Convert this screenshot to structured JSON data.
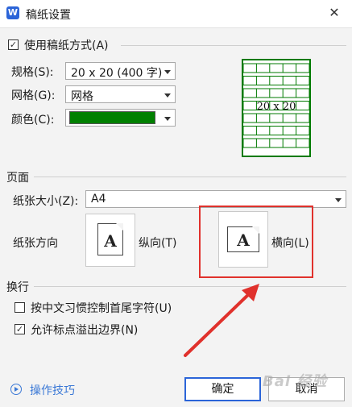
{
  "window": {
    "title": "稿纸设置",
    "app_icon_letter": "W",
    "close_glyph": "✕"
  },
  "use_paper": {
    "checked": true,
    "label": "使用稿纸方式(A)"
  },
  "spec": {
    "label": "规格(S):",
    "value": "20 x 20 (400 字)"
  },
  "grid": {
    "label": "网格(G):",
    "value": "网格"
  },
  "color": {
    "label": "颜色(C):",
    "value": "#008000"
  },
  "preview": {
    "text": "20 x 20",
    "line_color": "#007a00"
  },
  "page_section": {
    "title": "页面"
  },
  "paper_size": {
    "label": "纸张大小(Z):",
    "value": "A4"
  },
  "orientation": {
    "label": "纸张方向",
    "portrait_label": "纵向(T)",
    "landscape_label": "横向(L)",
    "icon_letter": "A",
    "selected": "landscape"
  },
  "wrap_section": {
    "title": "换行",
    "opt1": {
      "checked": false,
      "label": "按中文习惯控制首尾字符(U)"
    },
    "opt2": {
      "checked": true,
      "label": "允许标点溢出边界(N)"
    }
  },
  "footer": {
    "tips": "操作技巧",
    "ok": "确定",
    "cancel": "取消"
  },
  "annotation": {
    "color": "#e0312c"
  },
  "watermark": {
    "text": "Bai 经验"
  }
}
